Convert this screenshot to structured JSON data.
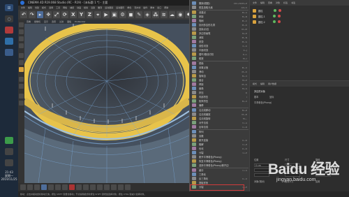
{
  "window": {
    "title": "CINEMA 4D R19.068 Studio (RC - R19) - [未标题 1 *] - 主要"
  },
  "menubar": [
    "文件",
    "编辑",
    "创建",
    "模式",
    "选择",
    "工具",
    "网格",
    "捕捉",
    "动画",
    "模拟",
    "渲染",
    "雕刻",
    "运动跟踪",
    "运动图形",
    "角色",
    "流水线",
    "插件",
    "脚本",
    "窗口",
    "帮助"
  ],
  "toolbar": {
    "axis_labels": [
      "X",
      "Y",
      "Z"
    ]
  },
  "viewport": {
    "menu": [
      "查看",
      "摄像机",
      "显示",
      "选项",
      "过滤",
      "面板",
      "ProRender"
    ]
  },
  "context_menu": {
    "items": [
      {
        "label": "撤销(视图)",
        "shortcut": "Ctrl+Shift+Z"
      },
      {
        "label": "框显选取元素",
        "shortcut": "Alt+S"
      },
      {
        "label": "创建点",
        "shortcut": "M~A"
      },
      {
        "label": "桥接",
        "shortcut": "M~B"
      },
      {
        "label": "笔刷",
        "shortcut": "M~C"
      },
      {
        "label": "封闭多边形孔洞",
        "shortcut": "M~D"
      },
      {
        "label": "连接点/边",
        "shortcut": "M~M"
      },
      {
        "label": "多边形画笔",
        "shortcut": "M~E"
      },
      {
        "label": "消除",
        "shortcut": "M~N"
      },
      {
        "label": "熨烫",
        "shortcut": "M~G"
      },
      {
        "label": "线性切割",
        "shortcut": "K~K"
      },
      {
        "label": "平面切割",
        "shortcut": "K~J"
      },
      {
        "label": "循环/路径切割",
        "shortcut": "K~L"
      },
      {
        "label": "磁铁",
        "shortcut": "M~I"
      },
      {
        "label": "镜像",
        "shortcut": ""
      },
      {
        "label": "设置点值",
        "shortcut": "M~U"
      },
      {
        "label": "滑动",
        "shortcut": "M~O"
      },
      {
        "label": "旋转边",
        "shortcut": "M~V"
      },
      {
        "label": "缝合",
        "shortcut": "M~P"
      },
      {
        "label": "焊接",
        "shortcut": "M~Q"
      },
      {
        "label": "倒角",
        "shortcut": "M~S"
      },
      {
        "label": "挤压",
        "shortcut": "D"
      },
      {
        "label": "内部挤压",
        "shortcut": "I"
      },
      {
        "label": "矩阵挤压",
        "shortcut": "M~X"
      },
      {
        "label": "偏移",
        "shortcut": ""
      },
      {
        "label": "沿法线移动",
        "shortcut": "M~Z"
      },
      {
        "label": "沿法线缩放",
        "shortcut": "M~#"
      },
      {
        "label": "沿法线旋转",
        "shortcut": "M~,"
      },
      {
        "label": "对齐法线",
        "shortcut": "U~A"
      },
      {
        "label": "反转法线",
        "shortcut": "U~R"
      },
      {
        "label": "阵列",
        "shortcut": ""
      },
      {
        "label": "克隆",
        "shortcut": ""
      },
      {
        "label": "断开连接",
        "shortcut": "U~D"
      },
      {
        "label": "融解",
        "shortcut": "U~Z"
      },
      {
        "label": "优化",
        "shortcut": "U~O"
      },
      {
        "label": "分裂",
        "shortcut": "U~P"
      },
      {
        "label": "断开平滑着色(Phong)",
        "shortcut": ""
      },
      {
        "label": "恢复平滑着色(Phong)",
        "shortcut": ""
      },
      {
        "label": "选择平滑着色(Phong)断开边",
        "shortcut": ""
      },
      {
        "label": "细分",
        "shortcut": "U~S"
      },
      {
        "label": "三角化",
        "shortcut": ""
      },
      {
        "label": "反三角化",
        "shortcut": "U~U"
      },
      {
        "label": "提取样条",
        "shortcut": ""
      },
      {
        "label": "分裂",
        "shortcut": "U~P"
      }
    ]
  },
  "object_panel": {
    "tabs": [
      "文件",
      "编辑",
      "查看",
      "对象",
      "标签",
      "书签"
    ],
    "objects": [
      {
        "name": "圆柱"
      },
      {
        "name": "圆柱.1"
      },
      {
        "name": "圆柱.2"
      }
    ]
  },
  "attribute_panel": {
    "tabs": [
      "模式",
      "编辑",
      "用户数据"
    ],
    "title": "多边形对象",
    "lines": [
      "基本",
      "坐标",
      "平滑着色(Phong)"
    ],
    "coord_labels": [
      "位置",
      "尺寸",
      "旋转"
    ],
    "coord_values": [
      "0 cm",
      "0 cm",
      "0 cm"
    ],
    "buttons": [
      "对象(相对)",
      "绝对尺寸",
      "应用"
    ]
  },
  "taskbar": {
    "time": "21:43",
    "date": "2019/11/25",
    "weekday": "星期一"
  },
  "status": {
    "text": "移动：点击并拖动鼠标移动元素。按住 SHIFT 键量化移动；节点编辑模式时按住 SHIFT 键增加选择对象；按住 CTRL 键减少选择对象。"
  },
  "watermark": {
    "brand": "Baidu 经验",
    "url": "jingyan.baidu.com"
  },
  "colors": {
    "selection_highlight": "#d23b3b",
    "polygon_selection": "#e8c34a",
    "mesh_wire": "#7aa8d8"
  }
}
